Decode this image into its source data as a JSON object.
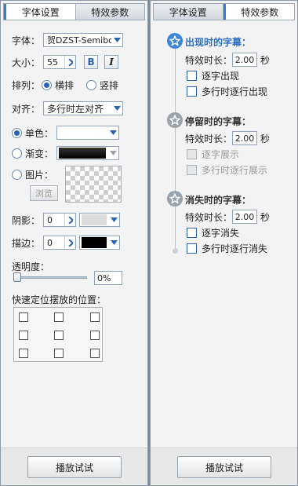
{
  "left": {
    "tabs": [
      {
        "label": "字体设置",
        "active": true
      },
      {
        "label": "特效参数",
        "active": false
      }
    ],
    "font": {
      "label": "字体：",
      "value": "贺DZST-Semibold"
    },
    "size": {
      "label": "大小：",
      "value": "55",
      "bold_label": "B",
      "italic_label": "I"
    },
    "arrange": {
      "label": "排列：",
      "options": [
        {
          "label": "横排",
          "selected": true
        },
        {
          "label": "竖排",
          "selected": false
        }
      ]
    },
    "align": {
      "label": "对齐：",
      "value": "多行时左对齐"
    },
    "fill": {
      "solid": {
        "label": "单色：",
        "selected": true,
        "color": "#ffffff"
      },
      "gradient": {
        "label": "渐变：",
        "selected": false,
        "color": "#111111"
      },
      "image": {
        "label": "图片：",
        "selected": false,
        "browse_label": "浏览"
      }
    },
    "shadow": {
      "label": "阴影：",
      "value": "0",
      "color": "#dcdcdc"
    },
    "stroke": {
      "label": "描边：",
      "value": "0",
      "color": "#000000"
    },
    "opacity": {
      "label": "透明度：",
      "value": "0%",
      "level": 0
    },
    "position": {
      "label": "快速定位摆放的位置："
    },
    "play_label": "播放试试"
  },
  "right": {
    "tabs": [
      {
        "label": "字体设置",
        "active": false
      },
      {
        "label": "特效参数",
        "active": true
      }
    ],
    "appear": {
      "title": "出现时的字幕：",
      "duration_label": "特效时长：",
      "duration": "2.00",
      "unit": "秒",
      "opt1": "逐字出现",
      "opt2": "多行时逐行出现"
    },
    "stay": {
      "title": "停留时的字幕：",
      "duration_label": "特效时长：",
      "duration": "2.00",
      "unit": "秒",
      "opt1": "逐字展示",
      "opt2": "多行时逐行展示"
    },
    "vanish": {
      "title": "消失时的字幕：",
      "duration_label": "特效时长：",
      "duration": "2.00",
      "unit": "秒",
      "opt1": "逐字消失",
      "opt2": "多行时逐行消失"
    },
    "play_label": "播放试试"
  },
  "colors": {
    "accent": "#3e86d6",
    "border": "#8ea3b8",
    "panel_bg": "#f3f3f3"
  }
}
